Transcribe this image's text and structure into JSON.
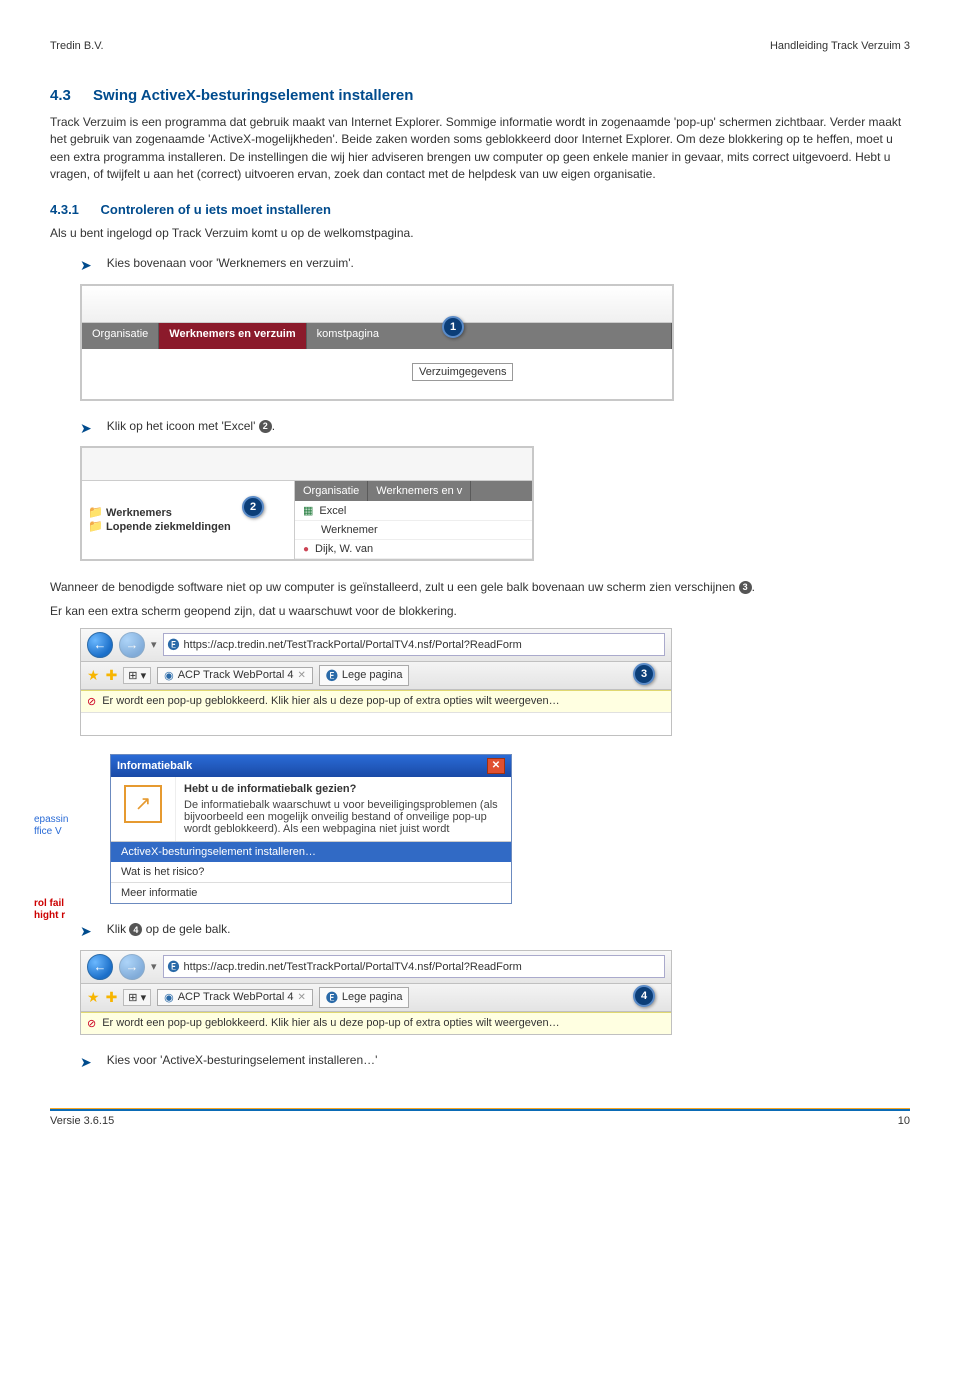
{
  "header": {
    "left": "Tredin B.V.",
    "right": "Handleiding Track Verzuim 3"
  },
  "section": {
    "number": "4.3",
    "title": "Swing ActiveX-besturingselement installeren"
  },
  "intro": "Track Verzuim is een programma dat gebruik maakt van Internet Explorer. Sommige informatie wordt in zogenaamde 'pop-up' schermen zichtbaar. Verder maakt het gebruik van zogenaamde 'ActiveX-mogelijkheden'. Beide zaken worden soms geblokkeerd door Internet Explorer. Om deze blokkering op te heffen, moet u een extra programma installeren. De instellingen die wij hier adviseren brengen uw computer op geen enkele manier in gevaar, mits correct uitgevoerd. Hebt u vragen, of twijfelt u aan het (correct) uitvoeren ervan, zoek dan contact met de helpdesk van uw eigen organisatie.",
  "subsection": {
    "number": "4.3.1",
    "title": "Controleren of u iets moet installeren"
  },
  "sub_intro": "Als u bent ingelogd op Track Verzuim komt u op de welkomstpagina.",
  "bullets": {
    "b1": "Kies bovenaan voor 'Werknemers en verzuim'.",
    "b2_pre": "Klik op het icoon met 'Excel' ",
    "b2_post": ".",
    "b3_pre": "Klik ",
    "b3_post": " op de gele balk.",
    "b4": "Kies voor 'ActiveX-besturingselement installeren…'"
  },
  "mid_para_pre": "Wanneer de benodigde software niet op uw computer is geïnstalleerd, zult u een gele balk bovenaan uw scherm zien verschijnen ",
  "mid_para_post": ".",
  "mid_para2": "Er kan een extra scherm geopend zijn, dat u waarschuwt voor de blokkering.",
  "ss1": {
    "tab1": "Organisatie",
    "tab2": "Werknemers en verzuim",
    "tab3": "komstpagina",
    "dropdown": "Verzuimgegevens"
  },
  "ss2": {
    "left_item1": "Werknemers",
    "left_item2": "Lopende ziekmeldingen",
    "tab1": "Organisatie",
    "tab2": "Werknemers en v",
    "row_excel": "Excel",
    "row_werk": "Werknemer",
    "row_person": "Dijk, W. van"
  },
  "ie": {
    "url": "https://acp.tredin.net/TestTrackPortal/PortalTV4.nsf/Portal?ReadForm",
    "tab_a": "ACP Track WebPortal 4",
    "tab_b": "Lege pagina",
    "bar": "Er wordt een pop-up geblokkeerd. Klik hier als u deze pop-up of extra opties wilt weergeven…"
  },
  "info": {
    "title": "Informatiebalk",
    "q": "Hebt u de informatiebalk gezien?",
    "body": "De informatiebalk waarschuwt u voor beveiligingsproblemen (als bijvoorbeeld een mogelijk onveilig bestand of onveilige pop-up wordt geblokkeerd). Als een webpagina niet juist wordt",
    "m1": "ActiveX-besturingselement installeren…",
    "m2": "Wat is het risico?",
    "m3": "Meer informatie",
    "side1a": "epassin",
    "side1b": "ffice V",
    "side2a": "rol fail",
    "side2b": "hight r"
  },
  "footer": {
    "left": "Versie 3.6.15",
    "right": "10"
  }
}
